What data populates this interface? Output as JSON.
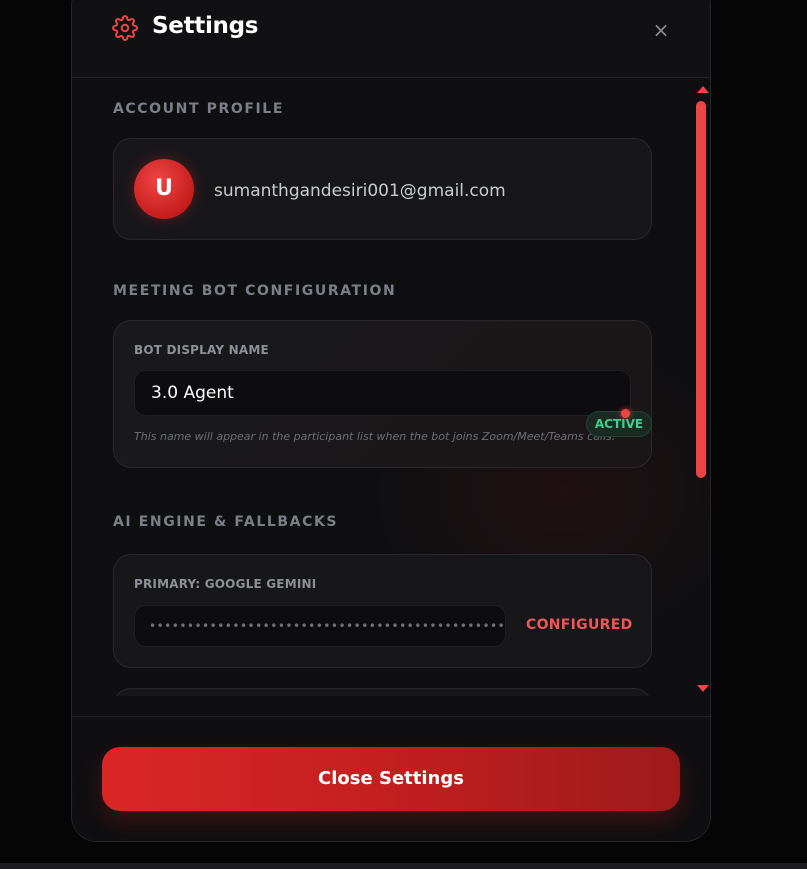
{
  "header": {
    "title": "Settings",
    "gear_icon": "gear-icon",
    "close_icon": "close-icon",
    "close_glyph": "×"
  },
  "account": {
    "section_label": "ACCOUNT PROFILE",
    "avatar_initial": "U",
    "email": "sumanthgandesiri001@gmail.com"
  },
  "bot": {
    "section_label": "MEETING BOT CONFIGURATION",
    "field_label": "BOT DISPLAY NAME",
    "value": "3.0 Agent",
    "hint": "This name will appear in the participant list when the bot joins Zoom/Meet/Teams calls."
  },
  "ai_engine": {
    "section_label": "AI ENGINE & FALLBACKS",
    "status_badge": "ACTIVE",
    "primary_label": "PRIMARY: GOOGLE GEMINI",
    "primary_key_masked": "••••••••••••••••••••••••••••••••••••••••••••••••••••••••",
    "primary_status": "CONFIGURED"
  },
  "footer": {
    "close_button_label": "Close Settings"
  },
  "colors": {
    "accent": "#ef4444",
    "active_badge": "#3fcf8e",
    "background": "#0f0f11"
  }
}
